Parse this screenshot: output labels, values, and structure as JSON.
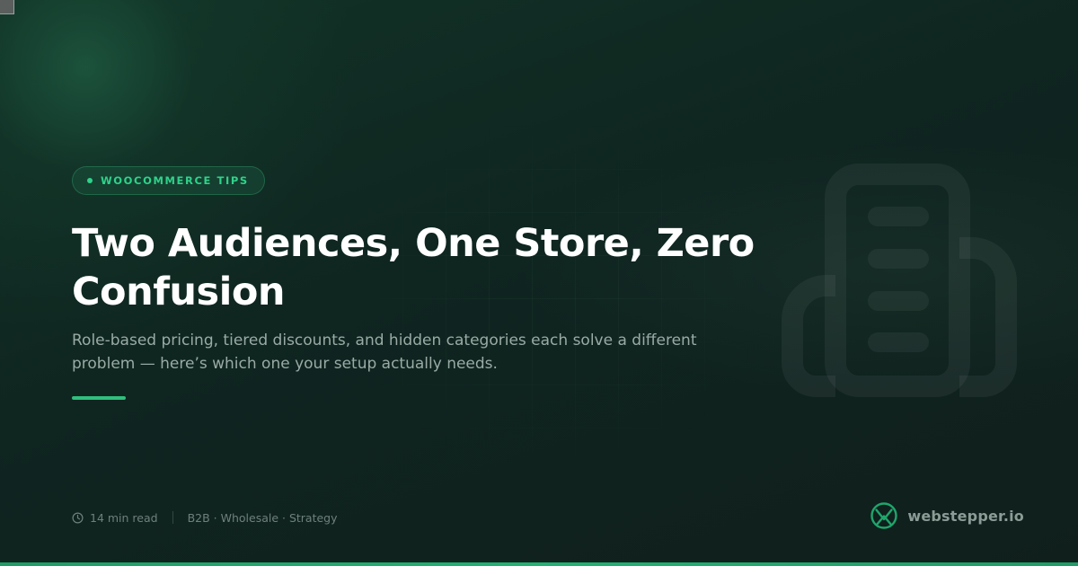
{
  "tag": {
    "label": "WOOCOMMERCE TIPS"
  },
  "headline": {
    "title": "Two Audiences, One Store, Zero Confusion",
    "subtitle": "Role-based pricing, tiered discounts, and hidden categories each solve a different problem — here’s which one your setup actually needs."
  },
  "meta": {
    "read_time": "14 min read",
    "topics": "B2B · Wholesale · Strategy"
  },
  "brand": {
    "name": "webstepper.io"
  },
  "icons": {
    "tag": "status-dot-icon",
    "meta": "clock-icon",
    "illustration": "building-icon",
    "logo": "webstepper-logo-icon"
  },
  "colors": {
    "accent": "#2fd28a",
    "background": "#0f2520",
    "title": "#ffffff",
    "subtitle": "#9aaba5",
    "muted": "#6f807b"
  }
}
